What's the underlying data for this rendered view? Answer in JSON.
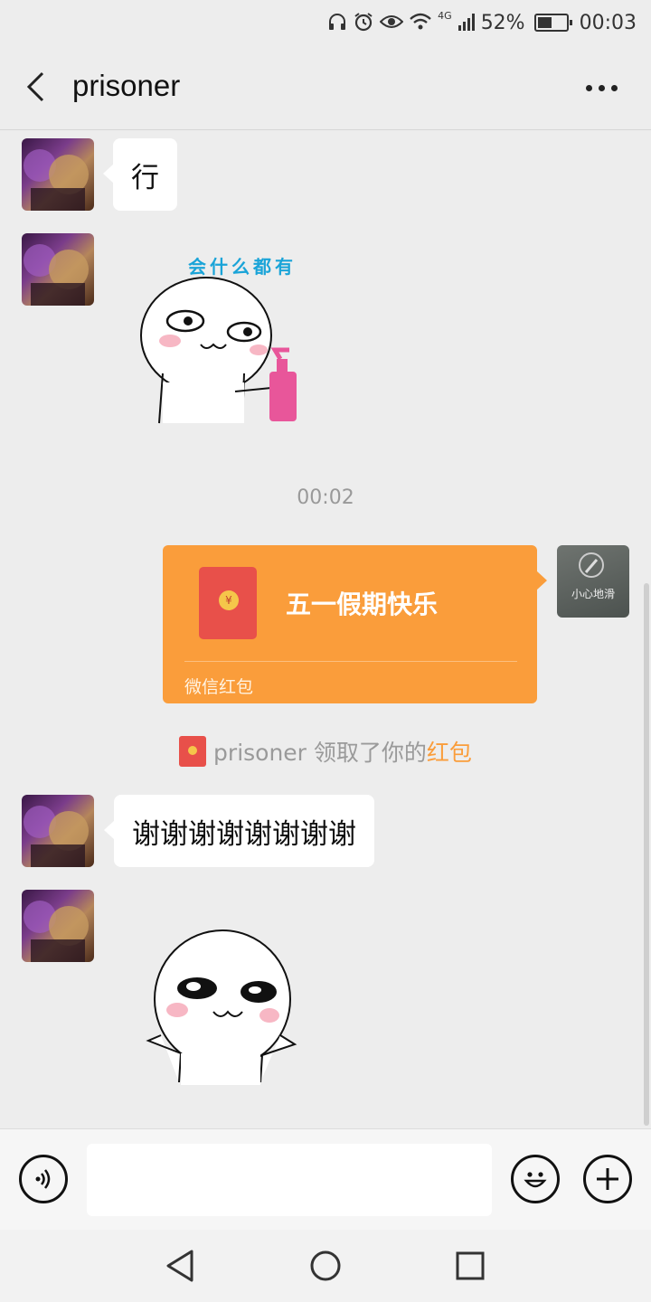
{
  "status_bar": {
    "network": "4G",
    "battery_percent": "52%",
    "battery_level": 0.52,
    "time": "00:03",
    "icons": [
      "headphones-icon",
      "alarm-icon",
      "eye-icon",
      "wifi-icon",
      "signal-icon",
      "battery-icon"
    ]
  },
  "header": {
    "title": "prisoner",
    "back_icon": "chevron-left-icon",
    "more_icon": "more-dots-icon"
  },
  "messages": [
    {
      "from": "other",
      "type": "text",
      "text": "行"
    },
    {
      "from": "other",
      "type": "sticker",
      "caption": "会什么都有"
    },
    {
      "type": "time",
      "text": "00:02"
    },
    {
      "from": "self",
      "type": "red_packet",
      "title": "五一假期快乐",
      "footer": "微信红包",
      "avatar_caption": "小心地滑"
    },
    {
      "type": "system",
      "name": "prisoner",
      "text": " 领取了你的",
      "highlight": "红包"
    },
    {
      "from": "other",
      "type": "text",
      "text": "谢谢谢谢谢谢谢谢"
    },
    {
      "from": "other",
      "type": "sticker",
      "caption": ""
    }
  ],
  "input_bar": {
    "voice_icon": "voice-icon",
    "emoji_icon": "emoji-icon",
    "plus_icon": "plus-icon",
    "placeholder": ""
  },
  "nav": {
    "icons": [
      "nav-back-icon",
      "nav-home-icon",
      "nav-recent-icon"
    ]
  },
  "colors": {
    "background": "#ededed",
    "bubble_other": "#ffffff",
    "red_packet": "#fa9d3b",
    "highlight": "#fa9d3b"
  }
}
